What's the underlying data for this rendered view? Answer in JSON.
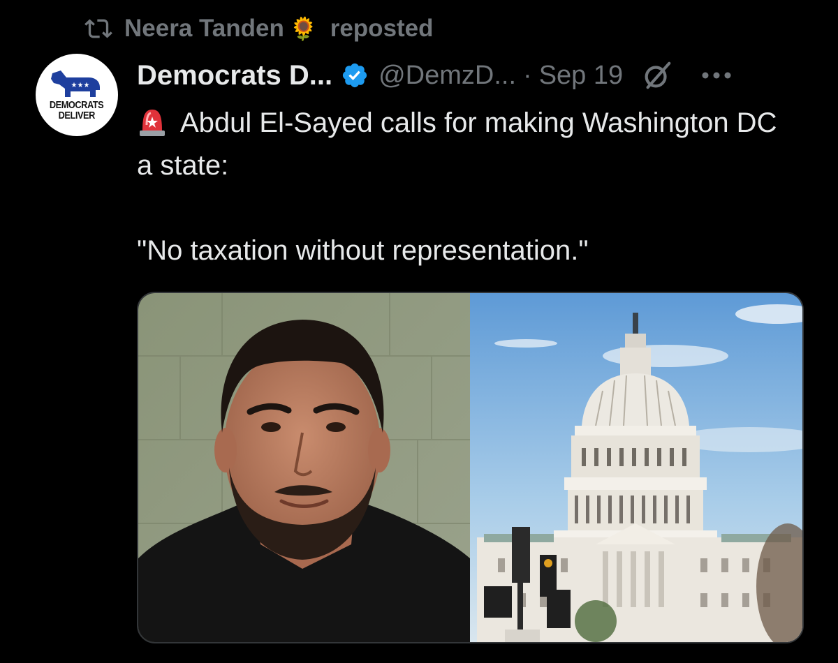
{
  "repost": {
    "icon": "retweet-icon",
    "user": "Neera Tanden",
    "emoji": "🌻",
    "label": "reposted"
  },
  "post": {
    "avatar_icon": "democrats-deliver-logo",
    "avatar_text_line1": "DEMOCRATS",
    "avatar_text_line2": "DELIVER",
    "author": "Democrats D...",
    "verified_icon": "verified-badge-icon",
    "handle": "@DemzD...",
    "separator": "·",
    "date": "Sep 19",
    "grok_icon": "grok-icon",
    "more_icon": "more-icon",
    "siren_icon": "police-light-icon",
    "text_line1": "Abdul El-Sayed calls for making Washington DC a state:",
    "text_line2": "\"No taxation without representation.\"",
    "media": {
      "left": "photo-of-man-portrait",
      "right": "photo-of-us-capitol-building"
    }
  },
  "colors": {
    "background": "#000000",
    "text_primary": "#e7e9ea",
    "text_secondary": "#71767b",
    "verified": "#1d9bf0",
    "border": "#333639"
  }
}
